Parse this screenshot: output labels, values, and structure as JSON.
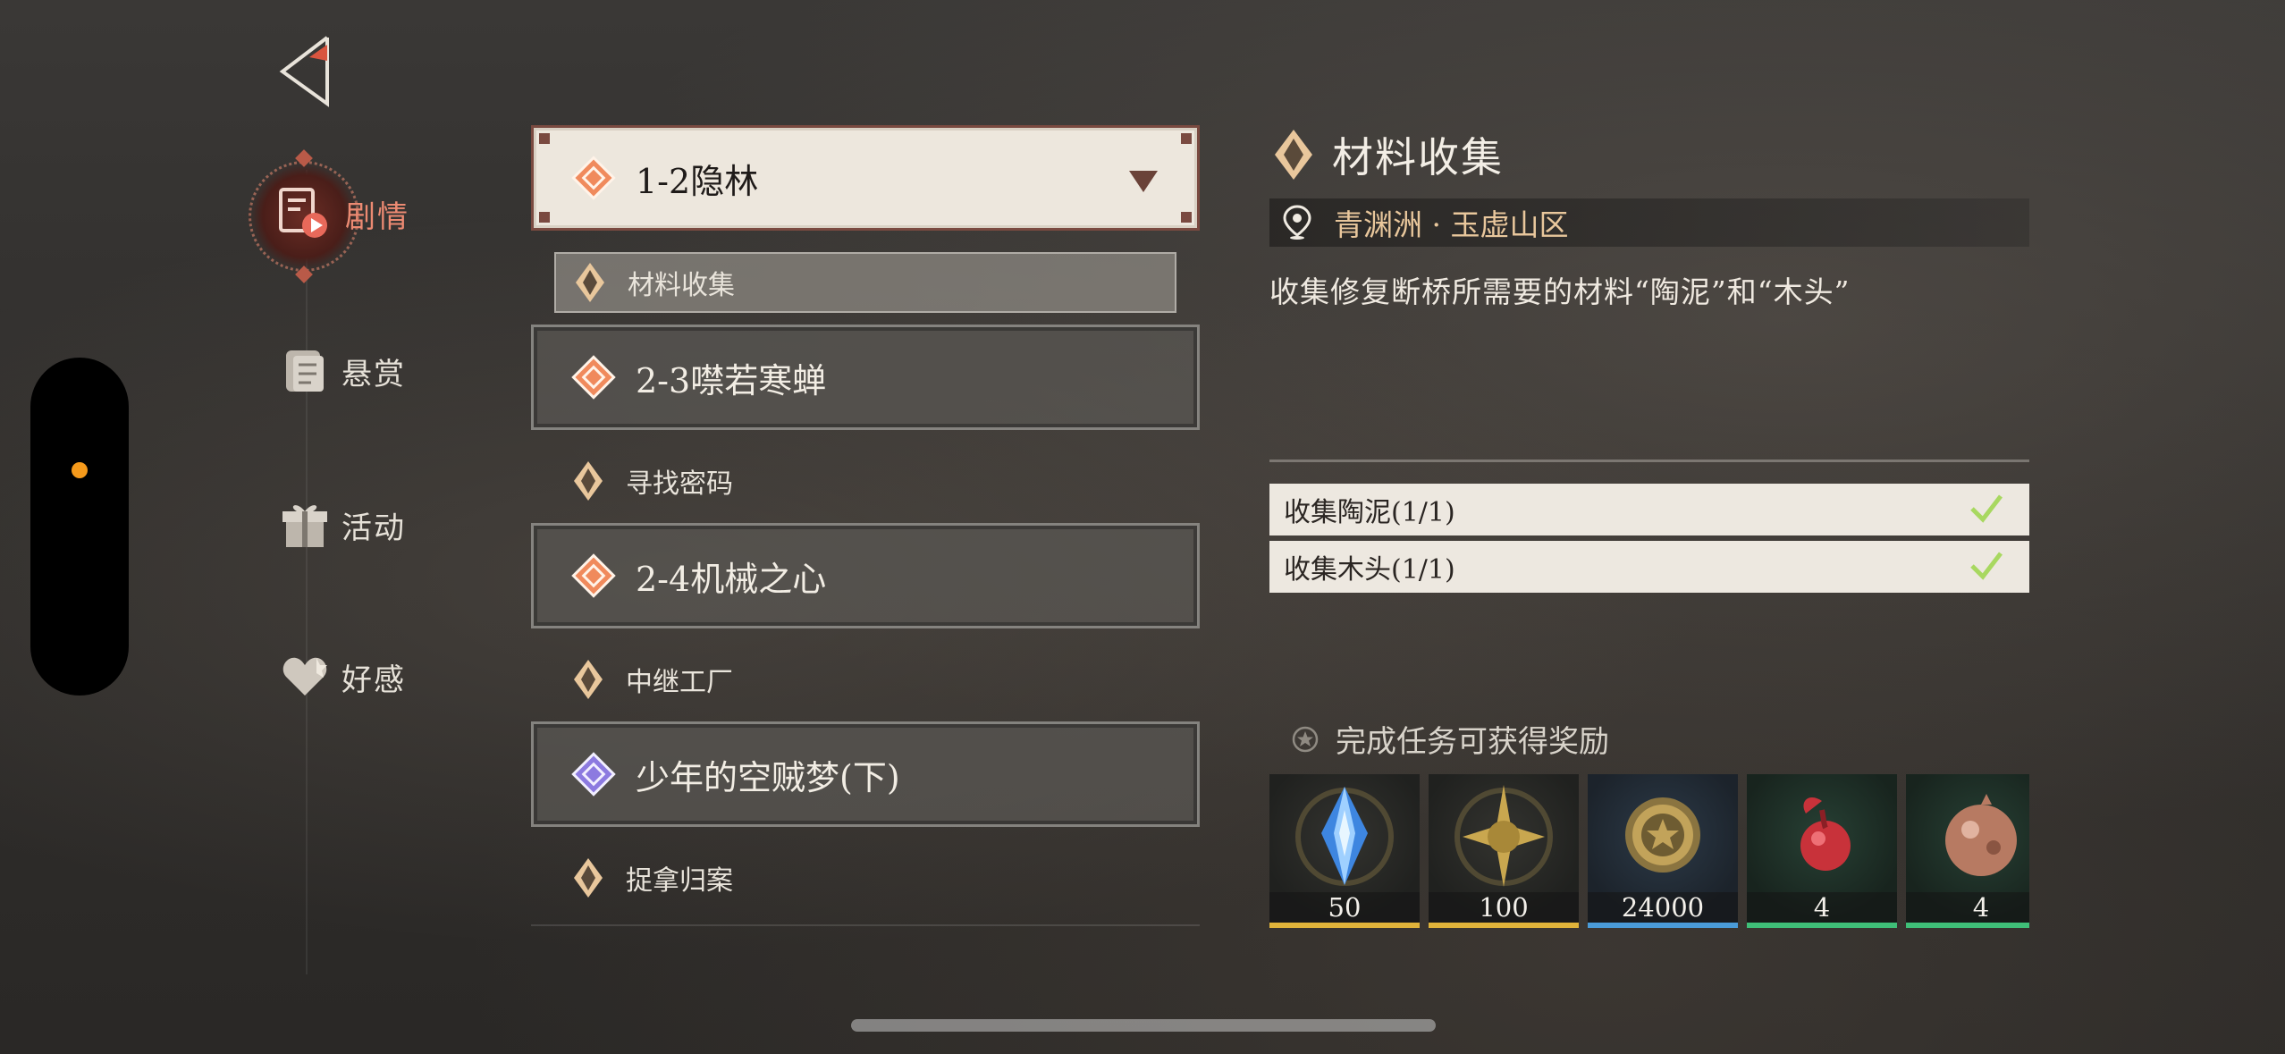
{
  "nav": {
    "items": [
      {
        "label": "剧情",
        "icon": "story-icon",
        "active": true
      },
      {
        "label": "悬赏",
        "icon": "scroll-icon",
        "active": false
      },
      {
        "label": "活动",
        "icon": "gift-icon",
        "active": false
      },
      {
        "label": "好感",
        "icon": "heart-icon",
        "active": false
      }
    ]
  },
  "quest_list": {
    "chapters": [
      {
        "label": "1-2隐林",
        "selected": true,
        "subquest": "材料收集"
      },
      {
        "label": "2-3噤若寒蝉",
        "selected": false,
        "subquest": "寻找密码"
      },
      {
        "label": "2-4机械之心",
        "selected": false,
        "subquest": "中继工厂"
      },
      {
        "label": "少年的空贼梦(下)",
        "selected": false,
        "subquest": "捉拿归案"
      }
    ]
  },
  "detail": {
    "title": "材料收集",
    "location": "青渊洲 · 玉虚山区",
    "description": "收集修复断桥所需要的材料“陶泥”和“木头”",
    "objectives": [
      {
        "label": "收集陶泥(1/1)",
        "done": true
      },
      {
        "label": "收集木头(1/1)",
        "done": true
      }
    ],
    "rewards_heading": "完成任务可获得奖励",
    "rewards": [
      {
        "icon": "blue-crystal-icon",
        "count": "50",
        "rarity_color": "#e0b33a"
      },
      {
        "icon": "gold-star-emblem-icon",
        "count": "100",
        "rarity_color": "#e0b33a"
      },
      {
        "icon": "gold-coin-icon",
        "count": "24000",
        "rarity_color": "#4a9bd8"
      },
      {
        "icon": "red-fruit-icon",
        "count": "4",
        "rarity_color": "#3fbf78"
      },
      {
        "icon": "copper-ore-icon",
        "count": "4",
        "rarity_color": "#3fbf78"
      }
    ]
  },
  "colors": {
    "accent": "#ec8a72",
    "indicator": "#f59a1b"
  }
}
